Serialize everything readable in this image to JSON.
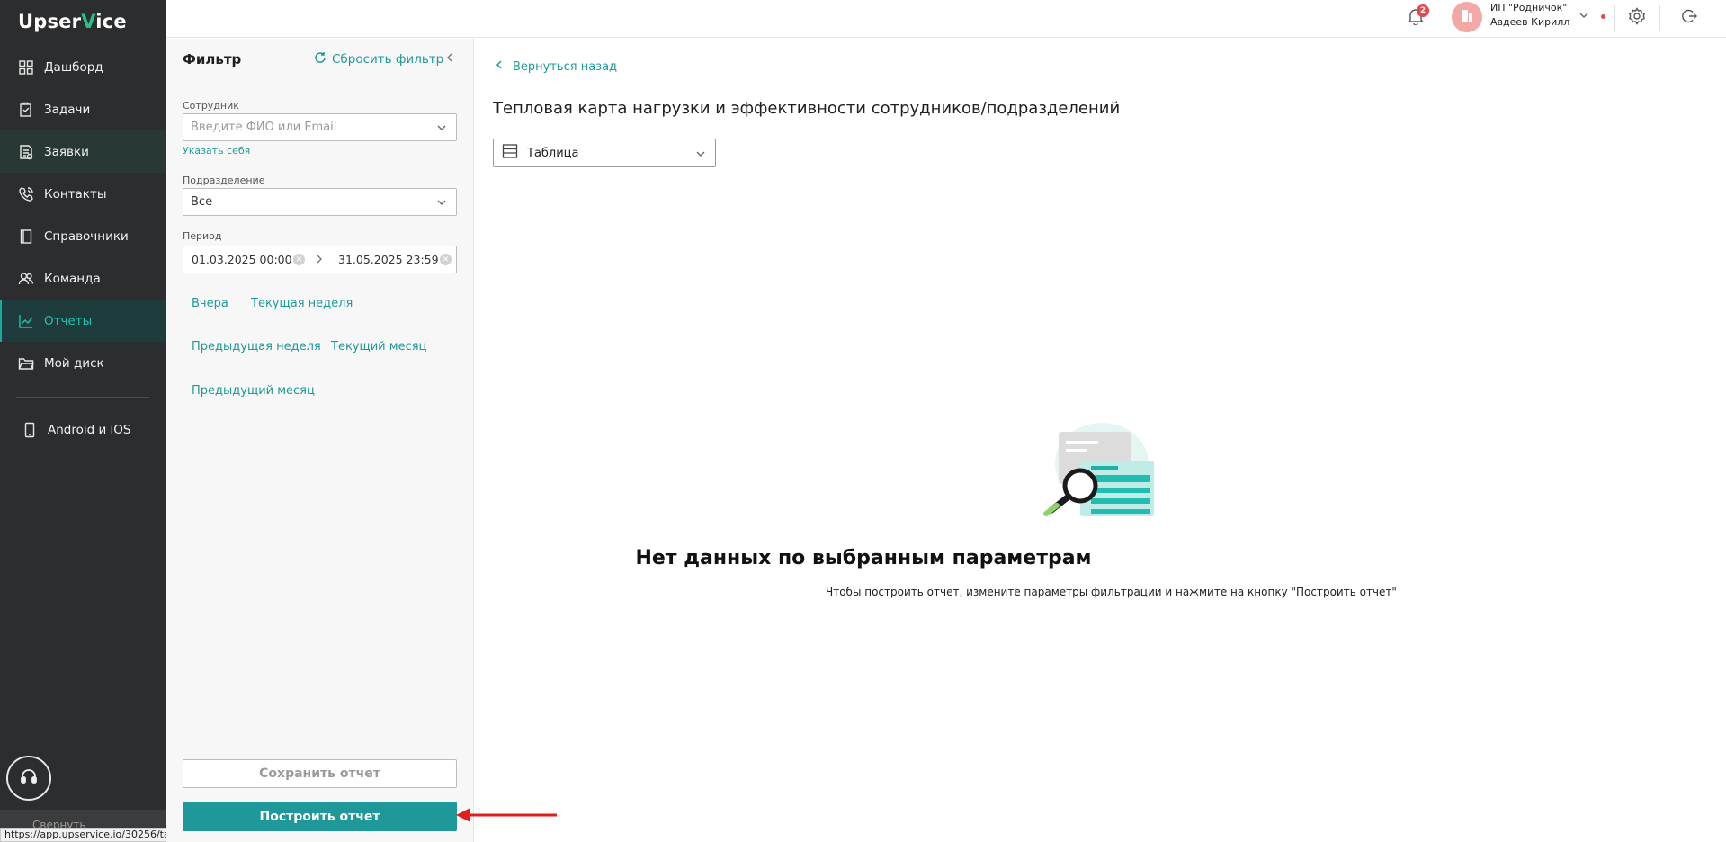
{
  "brand": {
    "logo_prefix": "Upser",
    "logo_check": "V",
    "logo_suffix": "ice"
  },
  "sidebar": {
    "items": [
      {
        "label": "Дашборд",
        "icon": "dashboard-icon"
      },
      {
        "label": "Задачи",
        "icon": "tasks-icon"
      },
      {
        "label": "Заявки",
        "icon": "requests-icon"
      },
      {
        "label": "Контакты",
        "icon": "phone-icon"
      },
      {
        "label": "Справочники",
        "icon": "book-icon"
      },
      {
        "label": "Команда",
        "icon": "team-icon"
      },
      {
        "label": "Отчеты",
        "icon": "chart-icon"
      },
      {
        "label": "Мой диск",
        "icon": "folder-icon"
      },
      {
        "label": "Android и iOS",
        "icon": "mobile-icon"
      }
    ],
    "collapse_label": "Свернуть",
    "status_url": "https://app.upservice.io/30256/tasks/all"
  },
  "topbar": {
    "notifications_count": "2",
    "org_name": "ИП \"Родничок\"",
    "user_name": "Авдеев Кирилл"
  },
  "filter": {
    "title": "Фильтр",
    "reset_label": "Сбросить фильтр",
    "employee_label": "Сотрудник",
    "employee_placeholder": "Введите ФИО или Email",
    "self_link": "Указать себя",
    "department_label": "Подразделение",
    "department_value": "Все",
    "period_label": "Период",
    "period_from": "01.03.2025 00:00",
    "period_to": "31.05.2025 23:59",
    "presets": [
      "Вчера",
      "Текущая неделя",
      "Предыдущая неделя",
      "Текущий месяц",
      "Предыдущий месяц"
    ],
    "save_label": "Сохранить отчет",
    "build_label": "Построить отчет"
  },
  "main": {
    "back_label": "Вернуться назад",
    "title": "Тепловая карта нагрузки и эффективности сотрудников/подразделений",
    "view_value": "Таблица",
    "empty_title": "Нет данных по выбранным параметрам",
    "empty_subtitle": "Чтобы построить отчет, измените параметры фильтрации и нажмите на кнопку \"Построить отчет\""
  },
  "colors": {
    "accent": "#1e9898",
    "sidebar_bg": "#2b2d2f",
    "badge": "#e5484d",
    "arrow": "#e01e1e"
  }
}
